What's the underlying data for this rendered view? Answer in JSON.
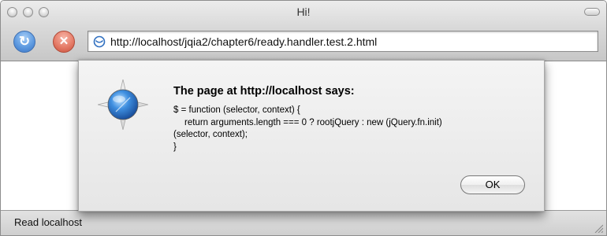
{
  "window": {
    "title": "Hi!"
  },
  "toolbar": {
    "reload_icon": "reload-icon",
    "stop_icon": "stop-icon",
    "url": "http://localhost/jqia2/chapter6/ready.handler.test.2.html"
  },
  "status_bar": {
    "text": "Read localhost"
  },
  "alert": {
    "title": "The page at http://localhost says:",
    "message_lines": [
      "$ = function (selector, context) {",
      "return arguments.length === 0 ? rootjQuery : new (jQuery.fn.init)",
      "(selector, context);",
      "}"
    ],
    "ok_label": "OK"
  }
}
